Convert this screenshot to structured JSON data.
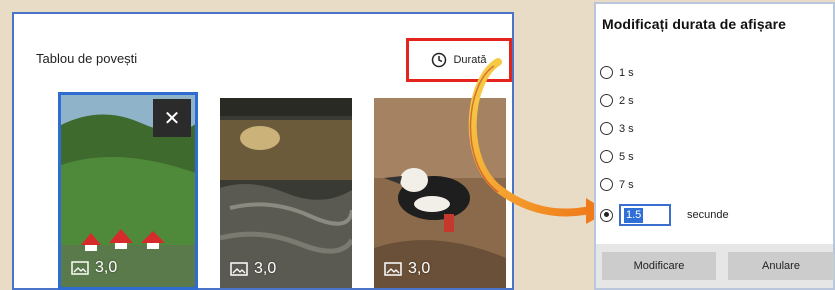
{
  "storyboard": {
    "title": "Tablou de povești",
    "duration_button_label": "Durată",
    "items": [
      {
        "duration": "3,0",
        "selected": true,
        "remove_label": "✕"
      },
      {
        "duration": "3,0",
        "selected": false
      },
      {
        "duration": "3,0",
        "selected": false
      }
    ]
  },
  "dialog": {
    "title": "Modificați durata de afișare",
    "options": [
      {
        "label": "1 s",
        "checked": false
      },
      {
        "label": "2 s",
        "checked": false
      },
      {
        "label": "3 s",
        "checked": false
      },
      {
        "label": "5 s",
        "checked": false
      },
      {
        "label": "7 s",
        "checked": false
      }
    ],
    "custom": {
      "value": "1.5",
      "unit": "secunde",
      "checked": true
    },
    "ok_label": "Modificare",
    "cancel_label": "Anulare"
  },
  "colors": {
    "highlight_border": "#e4231d",
    "accent_blue": "#2e6cd1",
    "arrow_orange": "#f39a1e"
  },
  "icons": [
    "clock-icon",
    "close-icon",
    "image-icon"
  ]
}
